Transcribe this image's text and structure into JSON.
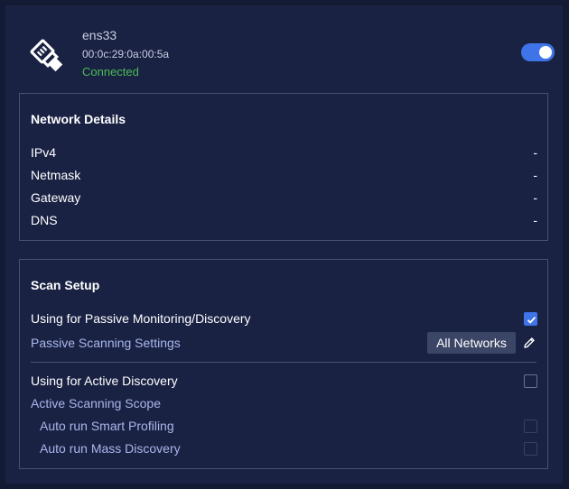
{
  "interface": {
    "name": "ens33",
    "mac": "00:0c:29:0a:00:5a",
    "status": "Connected",
    "icon": "ethernet-plug-icon",
    "enabled": true
  },
  "network_details": {
    "title": "Network Details",
    "rows": [
      {
        "label": "IPv4",
        "value": "-"
      },
      {
        "label": "Netmask",
        "value": "-"
      },
      {
        "label": "Gateway",
        "value": "-"
      },
      {
        "label": "DNS",
        "value": "-"
      }
    ]
  },
  "scan_setup": {
    "title": "Scan Setup",
    "passive_label": "Using for Passive Monitoring/Discovery",
    "passive_checked": true,
    "passive_settings_label": "Passive Scanning Settings",
    "passive_settings_value": "All Networks",
    "active_label": "Using for Active Discovery",
    "active_checked": false,
    "active_scope_label": "Active Scanning Scope",
    "smart_profiling_label": "Auto run Smart Profiling",
    "mass_discovery_label": "Auto run Mass Discovery"
  },
  "colors": {
    "background": "#1a2244",
    "accent": "#3f73e8",
    "connected": "#4cbb53",
    "sub_label": "#a9b6ea"
  }
}
